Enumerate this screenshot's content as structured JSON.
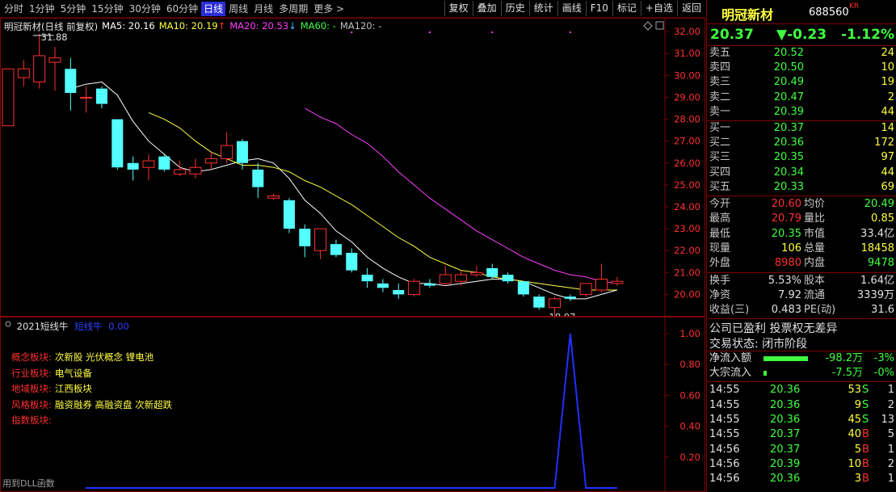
{
  "toolbar": {
    "periods": [
      "分时",
      "1分钟",
      "5分钟",
      "15分钟",
      "30分钟",
      "60分钟",
      "日线",
      "周线",
      "月线",
      "多周期",
      "更多 >"
    ],
    "active_period": "日线",
    "buttons": [
      "复权",
      "叠加",
      "历史",
      "统计",
      "画线",
      "F10",
      "标记",
      "+自选",
      "返回"
    ]
  },
  "main_chart": {
    "stock_title": "明冠新材(日线 前复权)",
    "ma5": "MA5: 20.16",
    "ma10": "MA10: 20.19",
    "ma20": "MA20: 20.53",
    "ma60": "MA60: -",
    "ma120": "MA120: -",
    "high_mark": "31.88",
    "low_mark": "18.97",
    "y_labels": [
      "32.00",
      "31.00",
      "30.00",
      "29.00",
      "28.00",
      "27.00",
      "26.00",
      "25.00",
      "24.00",
      "23.00",
      "22.00",
      "21.00",
      "20.00"
    ]
  },
  "chart_data": {
    "type": "candlestick",
    "ylim": [
      19.5,
      32.3
    ],
    "candles": [
      {
        "o": 27.7,
        "h": 30.3,
        "l": 27.7,
        "c": 30.3
      },
      {
        "o": 29.9,
        "h": 30.7,
        "l": 29.5,
        "c": 30.3
      },
      {
        "o": 29.7,
        "h": 31.9,
        "l": 29.4,
        "c": 30.9
      },
      {
        "o": 30.6,
        "h": 31.3,
        "l": 29.3,
        "c": 30.8
      },
      {
        "o": 30.3,
        "h": 30.8,
        "l": 28.4,
        "c": 29.2
      },
      {
        "o": 29.0,
        "h": 29.5,
        "l": 28.3,
        "c": 29.0
      },
      {
        "o": 29.4,
        "h": 29.5,
        "l": 28.5,
        "c": 28.7
      },
      {
        "o": 28.0,
        "h": 28.0,
        "l": 25.7,
        "c": 25.8
      },
      {
        "o": 26.0,
        "h": 26.3,
        "l": 25.2,
        "c": 25.7
      },
      {
        "o": 25.8,
        "h": 26.4,
        "l": 25.2,
        "c": 26.1
      },
      {
        "o": 26.3,
        "h": 26.4,
        "l": 25.6,
        "c": 25.7
      },
      {
        "o": 25.5,
        "h": 26.1,
        "l": 25.4,
        "c": 25.7
      },
      {
        "o": 25.5,
        "h": 26.2,
        "l": 25.3,
        "c": 25.8
      },
      {
        "o": 26.0,
        "h": 26.5,
        "l": 25.7,
        "c": 26.2
      },
      {
        "o": 26.2,
        "h": 27.4,
        "l": 26.0,
        "c": 26.8
      },
      {
        "o": 27.0,
        "h": 27.1,
        "l": 25.7,
        "c": 26.0
      },
      {
        "o": 25.7,
        "h": 26.0,
        "l": 24.4,
        "c": 24.9
      },
      {
        "o": 24.4,
        "h": 24.6,
        "l": 24.3,
        "c": 24.5
      },
      {
        "o": 24.3,
        "h": 24.4,
        "l": 22.8,
        "c": 23.0
      },
      {
        "o": 23.0,
        "h": 23.2,
        "l": 21.7,
        "c": 22.2
      },
      {
        "o": 22.0,
        "h": 23.0,
        "l": 21.6,
        "c": 23.0
      },
      {
        "o": 22.3,
        "h": 22.5,
        "l": 21.7,
        "c": 21.8
      },
      {
        "o": 21.9,
        "h": 22.1,
        "l": 21.0,
        "c": 21.1
      },
      {
        "o": 20.9,
        "h": 21.2,
        "l": 20.3,
        "c": 20.6
      },
      {
        "o": 20.5,
        "h": 20.7,
        "l": 20.1,
        "c": 20.3
      },
      {
        "o": 20.2,
        "h": 20.5,
        "l": 19.8,
        "c": 20.0
      },
      {
        "o": 20.0,
        "h": 20.7,
        "l": 19.9,
        "c": 20.6
      },
      {
        "o": 20.5,
        "h": 20.7,
        "l": 20.3,
        "c": 20.4
      },
      {
        "o": 20.5,
        "h": 21.3,
        "l": 20.4,
        "c": 20.9
      },
      {
        "o": 20.6,
        "h": 21.1,
        "l": 20.4,
        "c": 20.9
      },
      {
        "o": 20.9,
        "h": 21.3,
        "l": 20.8,
        "c": 21.0
      },
      {
        "o": 21.2,
        "h": 21.4,
        "l": 20.7,
        "c": 20.8
      },
      {
        "o": 20.9,
        "h": 21.0,
        "l": 20.5,
        "c": 20.6
      },
      {
        "o": 20.6,
        "h": 20.6,
        "l": 19.9,
        "c": 20.0
      },
      {
        "o": 19.9,
        "h": 20.0,
        "l": 19.3,
        "c": 19.4
      },
      {
        "o": 19.4,
        "h": 19.9,
        "l": 19.0,
        "c": 19.8
      },
      {
        "o": 19.9,
        "h": 20.0,
        "l": 19.7,
        "c": 19.8
      },
      {
        "o": 20.0,
        "h": 20.5,
        "l": 19.9,
        "c": 20.5
      },
      {
        "o": 20.2,
        "h": 21.4,
        "l": 20.1,
        "c": 20.7
      },
      {
        "o": 20.5,
        "h": 20.8,
        "l": 20.4,
        "c": 20.6
      }
    ],
    "ma5": [
      null,
      null,
      null,
      null,
      29.4,
      29.6,
      29.7,
      29.1,
      27.9,
      27.0,
      26.4,
      25.8,
      25.6,
      25.7,
      25.9,
      26.1,
      26.2,
      26.0,
      25.3,
      24.3,
      23.7,
      22.9,
      22.4,
      21.7,
      21.2,
      20.8,
      20.5,
      20.5,
      20.4,
      20.5,
      20.6,
      20.7,
      20.7,
      20.6,
      20.3,
      20.0,
      19.8,
      19.8,
      20.0,
      20.2
    ],
    "ma10": [
      null,
      null,
      null,
      null,
      null,
      null,
      null,
      null,
      null,
      28.3,
      28.0,
      27.6,
      27.0,
      26.5,
      26.2,
      25.9,
      25.9,
      25.8,
      25.6,
      25.2,
      24.9,
      24.5,
      24.1,
      23.6,
      23.1,
      22.6,
      22.2,
      21.7,
      21.4,
      21.1,
      21.0,
      20.8,
      20.7,
      20.6,
      20.5,
      20.4,
      20.3,
      20.2,
      20.2,
      20.2
    ],
    "ma20": [
      null,
      null,
      null,
      null,
      null,
      null,
      null,
      null,
      null,
      null,
      null,
      null,
      null,
      null,
      null,
      null,
      null,
      null,
      null,
      28.5,
      28.1,
      27.8,
      27.3,
      26.9,
      26.3,
      25.6,
      25.0,
      24.4,
      23.9,
      23.4,
      22.9,
      22.5,
      22.1,
      21.7,
      21.4,
      21.1,
      20.9,
      20.8,
      20.6,
      20.5
    ]
  },
  "indicator": {
    "title": "2021短线牛",
    "series_label": "短线牛",
    "value": "0.00",
    "y_labels": [
      "1.00",
      "0.80",
      "0.60",
      "0.40",
      "0.20"
    ],
    "blocks": [
      {
        "key": "概念板块:",
        "value": "次新股 光伏概念 锂电池"
      },
      {
        "key": "行业板块:",
        "value": "电气设备"
      },
      {
        "key": "地域板块:",
        "value": "江西板块"
      },
      {
        "key": "风格板块:",
        "value": "融资融券 高融资盘 次新超跌"
      },
      {
        "key": "指数板块:",
        "value": ""
      }
    ],
    "dll_note": "用到DLL函数",
    "signal": [
      0,
      0,
      0,
      0,
      0,
      0,
      0,
      0,
      0,
      0,
      0,
      0,
      0,
      0,
      0,
      0,
      0,
      0,
      0,
      0,
      0,
      0,
      0,
      0,
      0,
      0,
      0,
      0,
      0,
      0,
      0,
      0,
      0,
      0,
      0,
      0,
      1,
      0,
      0,
      0
    ]
  },
  "panel": {
    "name": "明冠新材",
    "code": "688560",
    "badge": "KR",
    "price": "20.37",
    "change": "▼-0.23",
    "change_pct": "-1.12%",
    "asks": [
      {
        "label": "卖五",
        "price": "20.52",
        "vol": "24"
      },
      {
        "label": "卖四",
        "price": "20.50",
        "vol": "10"
      },
      {
        "label": "卖三",
        "price": "20.49",
        "vol": "19"
      },
      {
        "label": "卖二",
        "price": "20.47",
        "vol": "2"
      },
      {
        "label": "卖一",
        "price": "20.39",
        "vol": "44"
      }
    ],
    "bids": [
      {
        "label": "买一",
        "price": "20.37",
        "vol": "14"
      },
      {
        "label": "买二",
        "price": "20.36",
        "vol": "172"
      },
      {
        "label": "买三",
        "price": "20.35",
        "vol": "97"
      },
      {
        "label": "买四",
        "price": "20.34",
        "vol": "44"
      },
      {
        "label": "买五",
        "price": "20.33",
        "vol": "69"
      }
    ],
    "stats1": [
      {
        "l1": "今开",
        "v1": "20.60",
        "c1": "#ff3030",
        "l2": "均价",
        "v2": "20.49",
        "c2": "#40ff40"
      },
      {
        "l1": "最高",
        "v1": "20.79",
        "c1": "#ff3030",
        "l2": "量比",
        "v2": "0.85",
        "c2": "#ffff40"
      },
      {
        "l1": "最低",
        "v1": "20.35",
        "c1": "#40ff40",
        "l2": "市值",
        "v2": "33.4亿",
        "c2": "#e0e0e0"
      },
      {
        "l1": "现量",
        "v1": "106",
        "c1": "#ffff40",
        "l2": "总量",
        "v2": "18458",
        "c2": "#ffff40"
      },
      {
        "l1": "外盘",
        "v1": "8980",
        "c1": "#ff3030",
        "l2": "内盘",
        "v2": "9478",
        "c2": "#40ff40"
      }
    ],
    "stats2": [
      {
        "l1": "换手",
        "v1": "5.53%",
        "c1": "#e0e0e0",
        "l2": "股本",
        "v2": "1.64亿",
        "c2": "#e0e0e0"
      },
      {
        "l1": "净资",
        "v1": "7.92",
        "c1": "#e0e0e0",
        "l2": "流通",
        "v2": "3339万",
        "c2": "#e0e0e0"
      },
      {
        "l1": "收益(三)",
        "v1": "0.483",
        "c1": "#e0e0e0",
        "l2": "PE(动)",
        "v2": "31.6",
        "c2": "#e0e0e0"
      }
    ],
    "company_note": "公司已盈利 投票权无差异",
    "trade_status": "交易状态: 闭市阶段",
    "net_inflow": {
      "label": "净流入额",
      "amount": "-98.2万",
      "pct": "-3%"
    },
    "block_inflow": {
      "label": "大宗流入",
      "amount": "-7.5万",
      "pct": "-0%"
    },
    "ticks": [
      {
        "time": "14:55",
        "price": "20.36",
        "vol": "53",
        "side": "S",
        "n": "1"
      },
      {
        "time": "14:55",
        "price": "20.36",
        "vol": "9",
        "side": "S",
        "n": "2"
      },
      {
        "time": "14:55",
        "price": "20.36",
        "vol": "45",
        "side": "S",
        "n": "13"
      },
      {
        "time": "14:55",
        "price": "20.37",
        "vol": "40",
        "side": "B",
        "n": "5"
      },
      {
        "time": "14:56",
        "price": "20.37",
        "vol": "5",
        "side": "B",
        "n": "1"
      },
      {
        "time": "14:56",
        "price": "20.39",
        "vol": "10",
        "side": "B",
        "n": "2"
      },
      {
        "time": "14:56",
        "price": "20.36",
        "vol": "3",
        "side": "B",
        "n": "1"
      }
    ]
  }
}
